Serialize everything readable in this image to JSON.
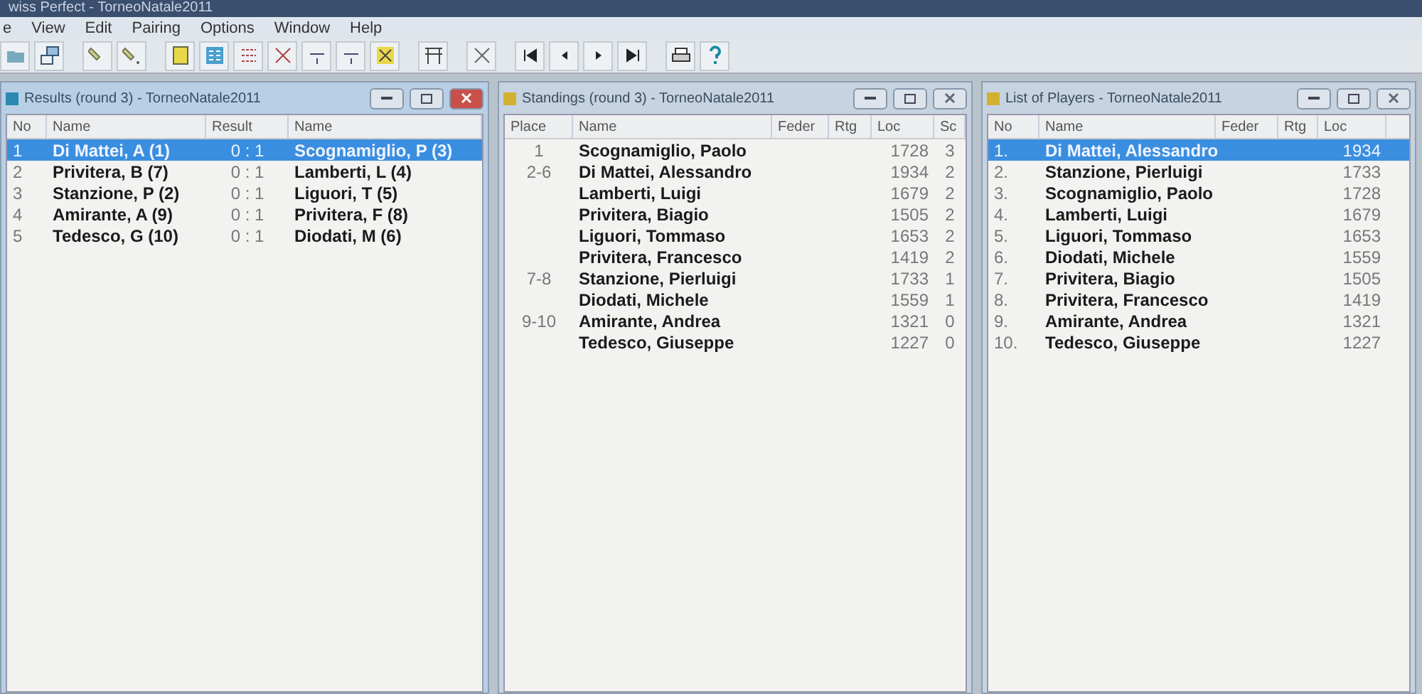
{
  "window": {
    "title": "wiss Perfect - TorneoNatale2011"
  },
  "menu": [
    "e",
    "View",
    "Edit",
    "Pairing",
    "Options",
    "Window",
    "Help"
  ],
  "panels": [
    {
      "kind": "results",
      "title": "Results  (round 3) - TorneoNatale2011",
      "active": true,
      "columns": [
        "No",
        "Name",
        "Result",
        "Name"
      ],
      "rows": [
        {
          "selected": true,
          "cells": [
            "1",
            "Di Mattei, A (1)",
            "0 : 1",
            "Scognamiglio, P (3)"
          ]
        },
        {
          "selected": false,
          "cells": [
            "2",
            "Privitera, B (7)",
            "0 : 1",
            "Lamberti, L (4)"
          ]
        },
        {
          "selected": false,
          "cells": [
            "3",
            "Stanzione, P (2)",
            "0 : 1",
            "Liguori, T (5)"
          ]
        },
        {
          "selected": false,
          "cells": [
            "4",
            "Amirante, A (9)",
            "0 : 1",
            "Privitera, F (8)"
          ]
        },
        {
          "selected": false,
          "cells": [
            "5",
            "Tedesco, G (10)",
            "0 : 1",
            "Diodati, M (6)"
          ]
        }
      ]
    },
    {
      "kind": "standings",
      "title": "Standings  (round 3) - TorneoNatale2011",
      "active": false,
      "columns": [
        "Place",
        "Name",
        "Feder",
        "Rtg",
        "Loc",
        "Sc"
      ],
      "rows": [
        {
          "selected": false,
          "cells": [
            "1",
            "Scognamiglio, Paolo",
            "",
            "",
            "1728",
            "3"
          ]
        },
        {
          "selected": false,
          "cells": [
            "2-6",
            "Di Mattei, Alessandro",
            "",
            "",
            "1934",
            "2"
          ]
        },
        {
          "selected": false,
          "cells": [
            "",
            "Lamberti, Luigi",
            "",
            "",
            "1679",
            "2"
          ]
        },
        {
          "selected": false,
          "cells": [
            "",
            "Privitera, Biagio",
            "",
            "",
            "1505",
            "2"
          ]
        },
        {
          "selected": false,
          "cells": [
            "",
            "Liguori, Tommaso",
            "",
            "",
            "1653",
            "2"
          ]
        },
        {
          "selected": false,
          "cells": [
            "",
            "Privitera, Francesco",
            "",
            "",
            "1419",
            "2"
          ]
        },
        {
          "selected": false,
          "cells": [
            "7-8",
            "Stanzione, Pierluigi",
            "",
            "",
            "1733",
            "1"
          ]
        },
        {
          "selected": false,
          "cells": [
            "",
            "Diodati, Michele",
            "",
            "",
            "1559",
            "1"
          ]
        },
        {
          "selected": false,
          "cells": [
            "9-10",
            "Amirante, Andrea",
            "",
            "",
            "1321",
            "0"
          ]
        },
        {
          "selected": false,
          "cells": [
            "",
            "Tedesco, Giuseppe",
            "",
            "",
            "1227",
            "0"
          ]
        }
      ]
    },
    {
      "kind": "players",
      "title": "List of Players - TorneoNatale2011",
      "active": false,
      "columns": [
        "No",
        "Name",
        "Feder",
        "Rtg",
        "Loc"
      ],
      "rows": [
        {
          "selected": true,
          "cells": [
            "1.",
            "Di Mattei, Alessandro",
            "",
            "",
            "1934"
          ]
        },
        {
          "selected": false,
          "cells": [
            "2.",
            "Stanzione, Pierluigi",
            "",
            "",
            "1733"
          ]
        },
        {
          "selected": false,
          "cells": [
            "3.",
            "Scognamiglio, Paolo",
            "",
            "",
            "1728"
          ]
        },
        {
          "selected": false,
          "cells": [
            "4.",
            "Lamberti, Luigi",
            "",
            "",
            "1679"
          ]
        },
        {
          "selected": false,
          "cells": [
            "5.",
            "Liguori, Tommaso",
            "",
            "",
            "1653"
          ]
        },
        {
          "selected": false,
          "cells": [
            "6.",
            "Diodati, Michele",
            "",
            "",
            "1559"
          ]
        },
        {
          "selected": false,
          "cells": [
            "7.",
            "Privitera, Biagio",
            "",
            "",
            "1505"
          ]
        },
        {
          "selected": false,
          "cells": [
            "8.",
            "Privitera, Francesco",
            "",
            "",
            "1419"
          ]
        },
        {
          "selected": false,
          "cells": [
            "9.",
            "Amirante, Andrea",
            "",
            "",
            "1321"
          ]
        },
        {
          "selected": false,
          "cells": [
            "10.",
            "Tedesco, Giuseppe",
            "",
            "",
            "1227"
          ]
        }
      ]
    }
  ]
}
